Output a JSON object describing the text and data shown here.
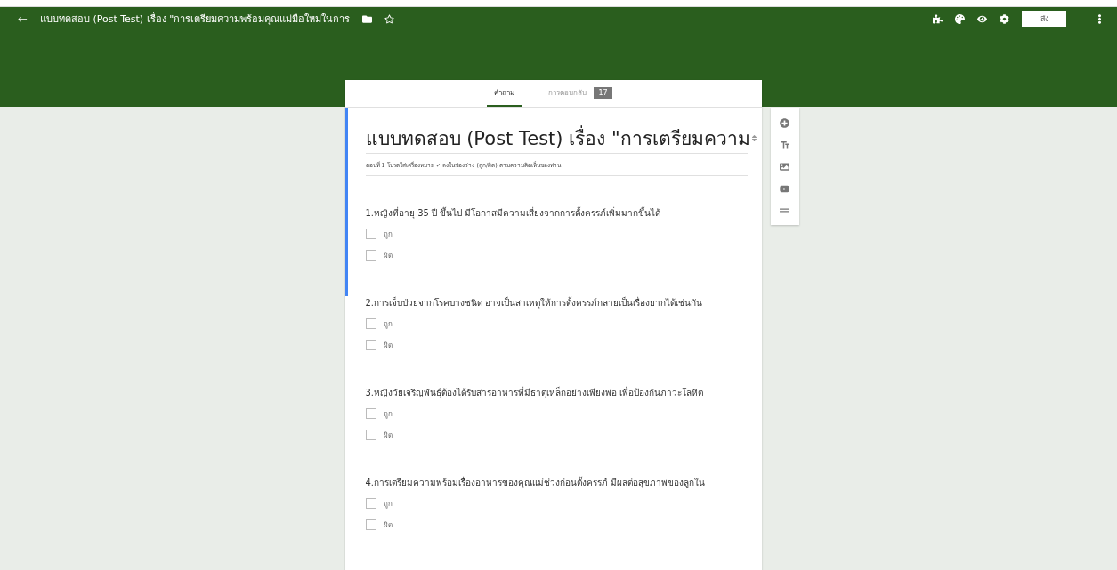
{
  "header": {
    "back": "←",
    "title": "แบบทดสอบ (Post Test) เรื่อง \"การเตรียมความพร้อมคุณแม่มือใหม่ในการ",
    "send": "ส่ง"
  },
  "tabs": [
    {
      "label": "คำถาม",
      "selected": true
    },
    {
      "label": "การตอบกลับ",
      "selected": false,
      "badge": "17"
    }
  ],
  "form": {
    "title": "แบบทดสอบ (Post Test) เรื่อง \"การเตรียมความ",
    "description": "ตอนที่ 1 โปรดใส่เครื่องหมาย ✓ ลงในช่องว่าง (ถูก/ผิด) ตามความคิดเห็นของท่าน"
  },
  "questions": [
    {
      "text": "1.หญิงที่อายุ 35 ปี ขึ้นไป มีโอกาสมีความเสี่ยงจากการตั้งครรภ์เพิ่มมากขึ้นได้",
      "active": true,
      "options": [
        {
          "label": "ถูก",
          "checked": false
        },
        {
          "label": "ผิด",
          "checked": false
        }
      ]
    },
    {
      "text": "2.การเจ็บป่วยจากโรคบางชนิด อาจเป็นสาเหตุให้การตั้งครรภ์กลายเป็นเรื่องยากได้เช่นกัน",
      "active": false,
      "options": [
        {
          "label": "ถูก",
          "checked": false
        },
        {
          "label": "ผิด",
          "checked": false
        }
      ]
    },
    {
      "text": "3.หญิงวัยเจริญพันธุ์ต้องได้รับสารอาหารที่มีธาตุเหล็กอย่างเพียงพอ เพื่อป้องกันภาวะโลหิต",
      "active": false,
      "options": [
        {
          "label": "ถูก",
          "checked": false
        },
        {
          "label": "ผิด",
          "checked": false
        }
      ]
    },
    {
      "text": "4.การเตรียมความพร้อมเรื่องอาหารของคุณแม่ช่วงก่อนตั้งครรภ์ มีผลต่อสุขภาพของลูกใน",
      "active": false,
      "options": [
        {
          "label": "ถูก",
          "checked": false
        },
        {
          "label": "ผิด",
          "checked": false
        }
      ]
    }
  ]
}
